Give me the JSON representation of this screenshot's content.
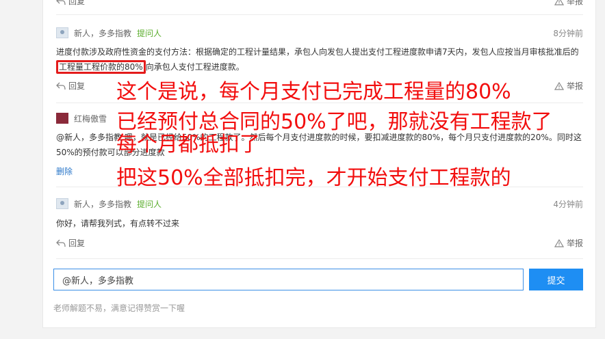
{
  "top_actions": {
    "reply": "回复",
    "report": "举报"
  },
  "comments": [
    {
      "user": "新人，多多指教",
      "badge": "提问人",
      "time": "8分钟前",
      "text_before": "进度付款涉及政府性资金的支付方法：根据确定的工程计量结果，承包人向发包人提出支付工程进度款申请7天内，发包人应按当月审核批准后的",
      "text_highlight": "工程量工程价款的80%",
      "text_after": "向承包人支付工程进度款。",
      "reply": "回复",
      "report": "举报"
    },
    {
      "user": "红梅傲雪",
      "text": "@新人，多多指教 嗯，就是已经给50%的工程款了。然后每个月支付进度款的时候，要扣减进度款的80%，每个月只支付进度款的20%。同时这50%的预付款可以部分进度款",
      "delete": "删除"
    },
    {
      "user": "新人，多多指教",
      "badge": "提问人",
      "time": "4分钟前",
      "text": "你好，请帮我列式，有点转不过来",
      "reply": "回复",
      "report": "举报"
    }
  ],
  "annotation": {
    "line1": "这个是说，每个月支付已完成工程量的80%",
    "line2": "已经预付总合同的50%了吧，那就没有工程款了",
    "line3": "每个月都抵扣了",
    "line4": "把这50%全部抵扣完，才开始支付工程款的",
    "color": "#f20e0e"
  },
  "composer": {
    "value": "@新人，多多指教",
    "submit": "提交",
    "note": "老师解题不易，满意记得赞赏一下喔"
  }
}
